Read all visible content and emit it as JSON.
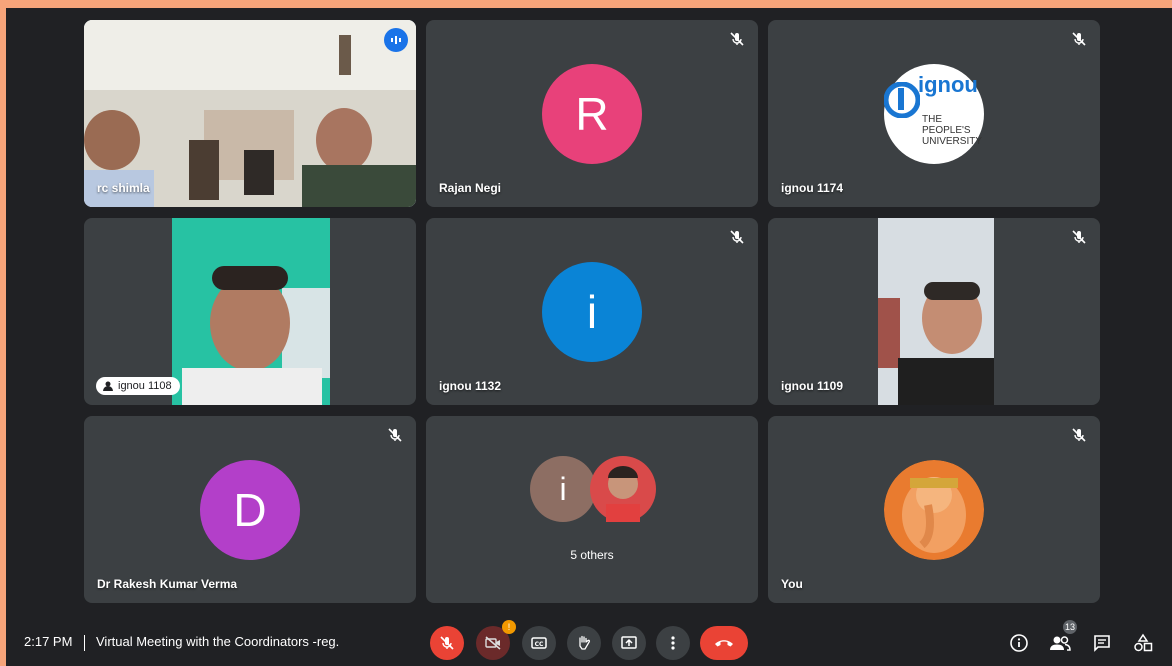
{
  "tiles": [
    {
      "name": "rc shimla"
    },
    {
      "name": "Rajan Negi",
      "initial": "R",
      "color": "#e8417a"
    },
    {
      "name": "ignou 1174",
      "logo_text": "ignou",
      "logo_sub": "THE PEOPLE'S UNIVERSITY"
    },
    {
      "name": "ignou 1108"
    },
    {
      "name": "ignou 1132",
      "initial": "i",
      "color": "#0a84d6"
    },
    {
      "name": "ignou 1109"
    },
    {
      "name": "Dr Rakesh Kumar Verma",
      "initial": "D",
      "color": "#b33fc9"
    },
    {
      "name": "5 others",
      "initial": "i",
      "color": "#8d6e63"
    },
    {
      "name": "You"
    }
  ],
  "bar": {
    "time": "2:17 PM",
    "title": "Virtual Meeting with the Coordinators -reg.",
    "participants_count": "13",
    "camera_badge": "!"
  },
  "icons": [
    "mic-off-icon",
    "camera-off-icon",
    "captions-icon",
    "raise-hand-icon",
    "present-icon",
    "more-icon",
    "end-call-icon",
    "info-icon",
    "people-icon",
    "chat-icon",
    "activities-icon"
  ]
}
